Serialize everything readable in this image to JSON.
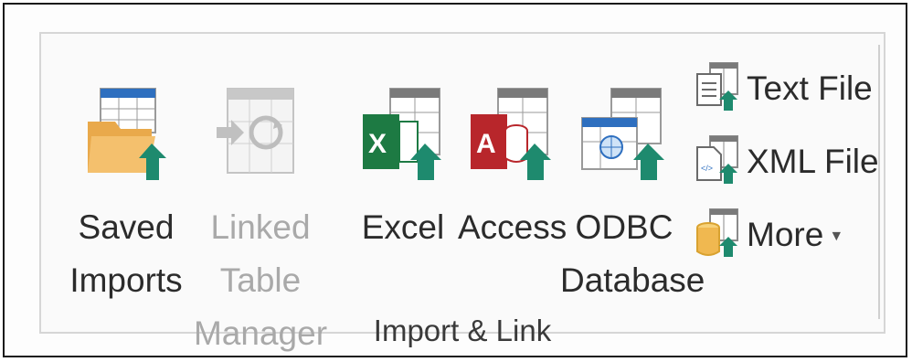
{
  "group": {
    "label": "Import & Link"
  },
  "buttons": {
    "saved_imports": {
      "label": "Saved\nImports",
      "icon": "saved-imports-icon"
    },
    "linked_table_manager": {
      "label": "Linked Table\nManager",
      "icon": "linked-table-manager-icon"
    },
    "excel": {
      "label": "Excel",
      "icon": "excel-import-icon"
    },
    "access": {
      "label": "Access",
      "icon": "access-import-icon"
    },
    "odbc": {
      "label": "ODBC\nDatabase",
      "icon": "odbc-database-icon"
    },
    "text_file": {
      "label": "Text File",
      "icon": "text-file-icon"
    },
    "xml_file": {
      "label": "XML File",
      "icon": "xml-file-icon"
    },
    "more": {
      "label": "More",
      "icon": "more-sources-icon"
    }
  },
  "colors": {
    "arrow": "#1e8a6e",
    "excel": "#1d7a43",
    "access": "#b8262b",
    "folder": "#f0b860",
    "table_header": "#2e6fbf"
  }
}
